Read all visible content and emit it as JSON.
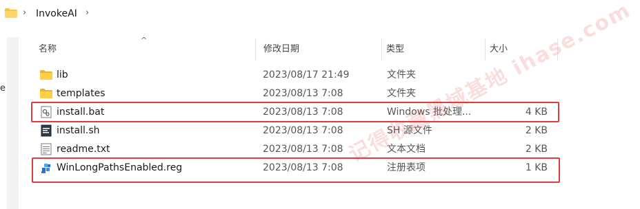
{
  "breadcrumb": {
    "folder_icon": "folder-icon",
    "path": [
      "InvokeAI"
    ]
  },
  "left_edge_char": "e",
  "columns": {
    "name": "名称",
    "modified": "修改日期",
    "type": "类型",
    "size": "大小"
  },
  "files": [
    {
      "name": "lib",
      "modified": "2023/08/17 21:49",
      "type": "文件夹",
      "size": "",
      "icon": "folder-icon"
    },
    {
      "name": "templates",
      "modified": "2023/08/13 7:08",
      "type": "文件夹",
      "size": "",
      "icon": "folder-icon"
    },
    {
      "name": "install.bat",
      "modified": "2023/08/13 7:08",
      "type": "Windows 批处理...",
      "size": "4 KB",
      "icon": "bat-file-icon"
    },
    {
      "name": "install.sh",
      "modified": "2023/08/13 7:08",
      "type": "SH 源文件",
      "size": "2 KB",
      "icon": "sh-file-icon"
    },
    {
      "name": "readme.txt",
      "modified": "2023/08/13 7:08",
      "type": "文本文档",
      "size": "2 KB",
      "icon": "txt-file-icon"
    },
    {
      "name": "WinLongPathsEnabled.reg",
      "modified": "2023/08/13 7:08",
      "type": "注册表项",
      "size": "1 KB",
      "icon": "reg-file-icon"
    }
  ],
  "highlight_color": "#e0393e",
  "watermark": "记得收藏黑域基地 ihase.com"
}
